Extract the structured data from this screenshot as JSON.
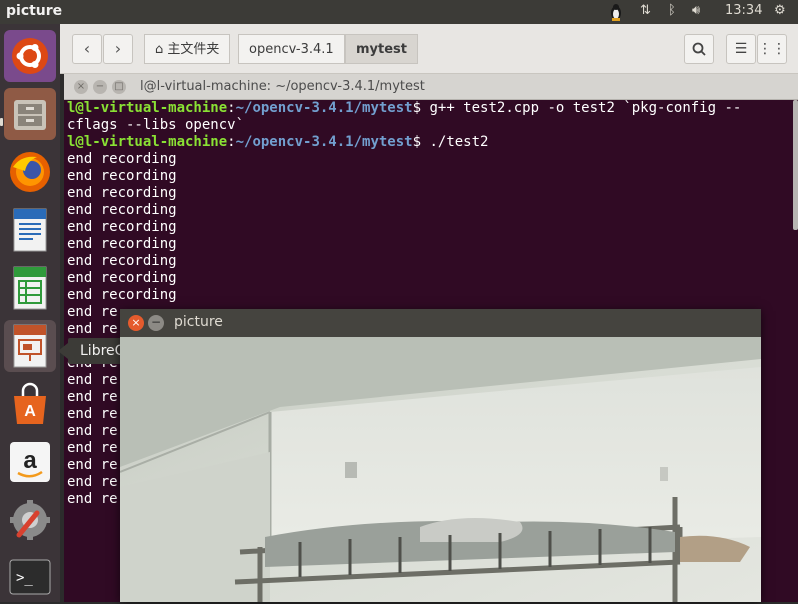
{
  "top_panel": {
    "app_title": "picture",
    "clock": "13:34"
  },
  "launcher": {
    "items": [
      {
        "name": "ubuntu-dash",
        "icon": "ubuntu-logo-icon"
      },
      {
        "name": "files",
        "icon": "file-cabinet-icon"
      },
      {
        "name": "firefox",
        "icon": "firefox-icon"
      },
      {
        "name": "libreoffice-writer",
        "icon": "writer-document-icon"
      },
      {
        "name": "libreoffice-calc",
        "icon": "calc-spreadsheet-icon"
      },
      {
        "name": "libreoffice-impress",
        "icon": "impress-presentation-icon"
      },
      {
        "name": "ubuntu-software",
        "icon": "shopping-bag-icon"
      },
      {
        "name": "amazon",
        "icon": "amazon-icon"
      },
      {
        "name": "system-settings",
        "icon": "settings-wrench-icon"
      },
      {
        "name": "terminal",
        "icon": "terminal-icon"
      }
    ],
    "tooltip": "LibreOffice Impress"
  },
  "files": {
    "crumb_home": "主文件夹",
    "crumb_1": "opencv-3.4.1",
    "crumb_2": "mytest"
  },
  "terminal": {
    "title": "l@l-virtual-machine: ~/opencv-3.4.1/mytest",
    "prompt_user": "l@l-virtual-machine",
    "prompt_path": "~/opencv-3.4.1/mytest",
    "cmd1": "$ g++ test2.cpp -o test2 `pkg-config --",
    "cmd1_cont": "cflags --libs opencv`",
    "cmd2": "$ ./test2",
    "output_full": "end recording",
    "output_partial": "end re",
    "full_lines": 9,
    "partial_lines": 12
  },
  "picture_window": {
    "title": "picture"
  },
  "colors": {
    "terminal_bg": "#300a24",
    "prompt_user": "#8ae234",
    "prompt_path": "#729fcf",
    "close_button": "#e55b2d",
    "panel_bg": "#3c3b37"
  }
}
